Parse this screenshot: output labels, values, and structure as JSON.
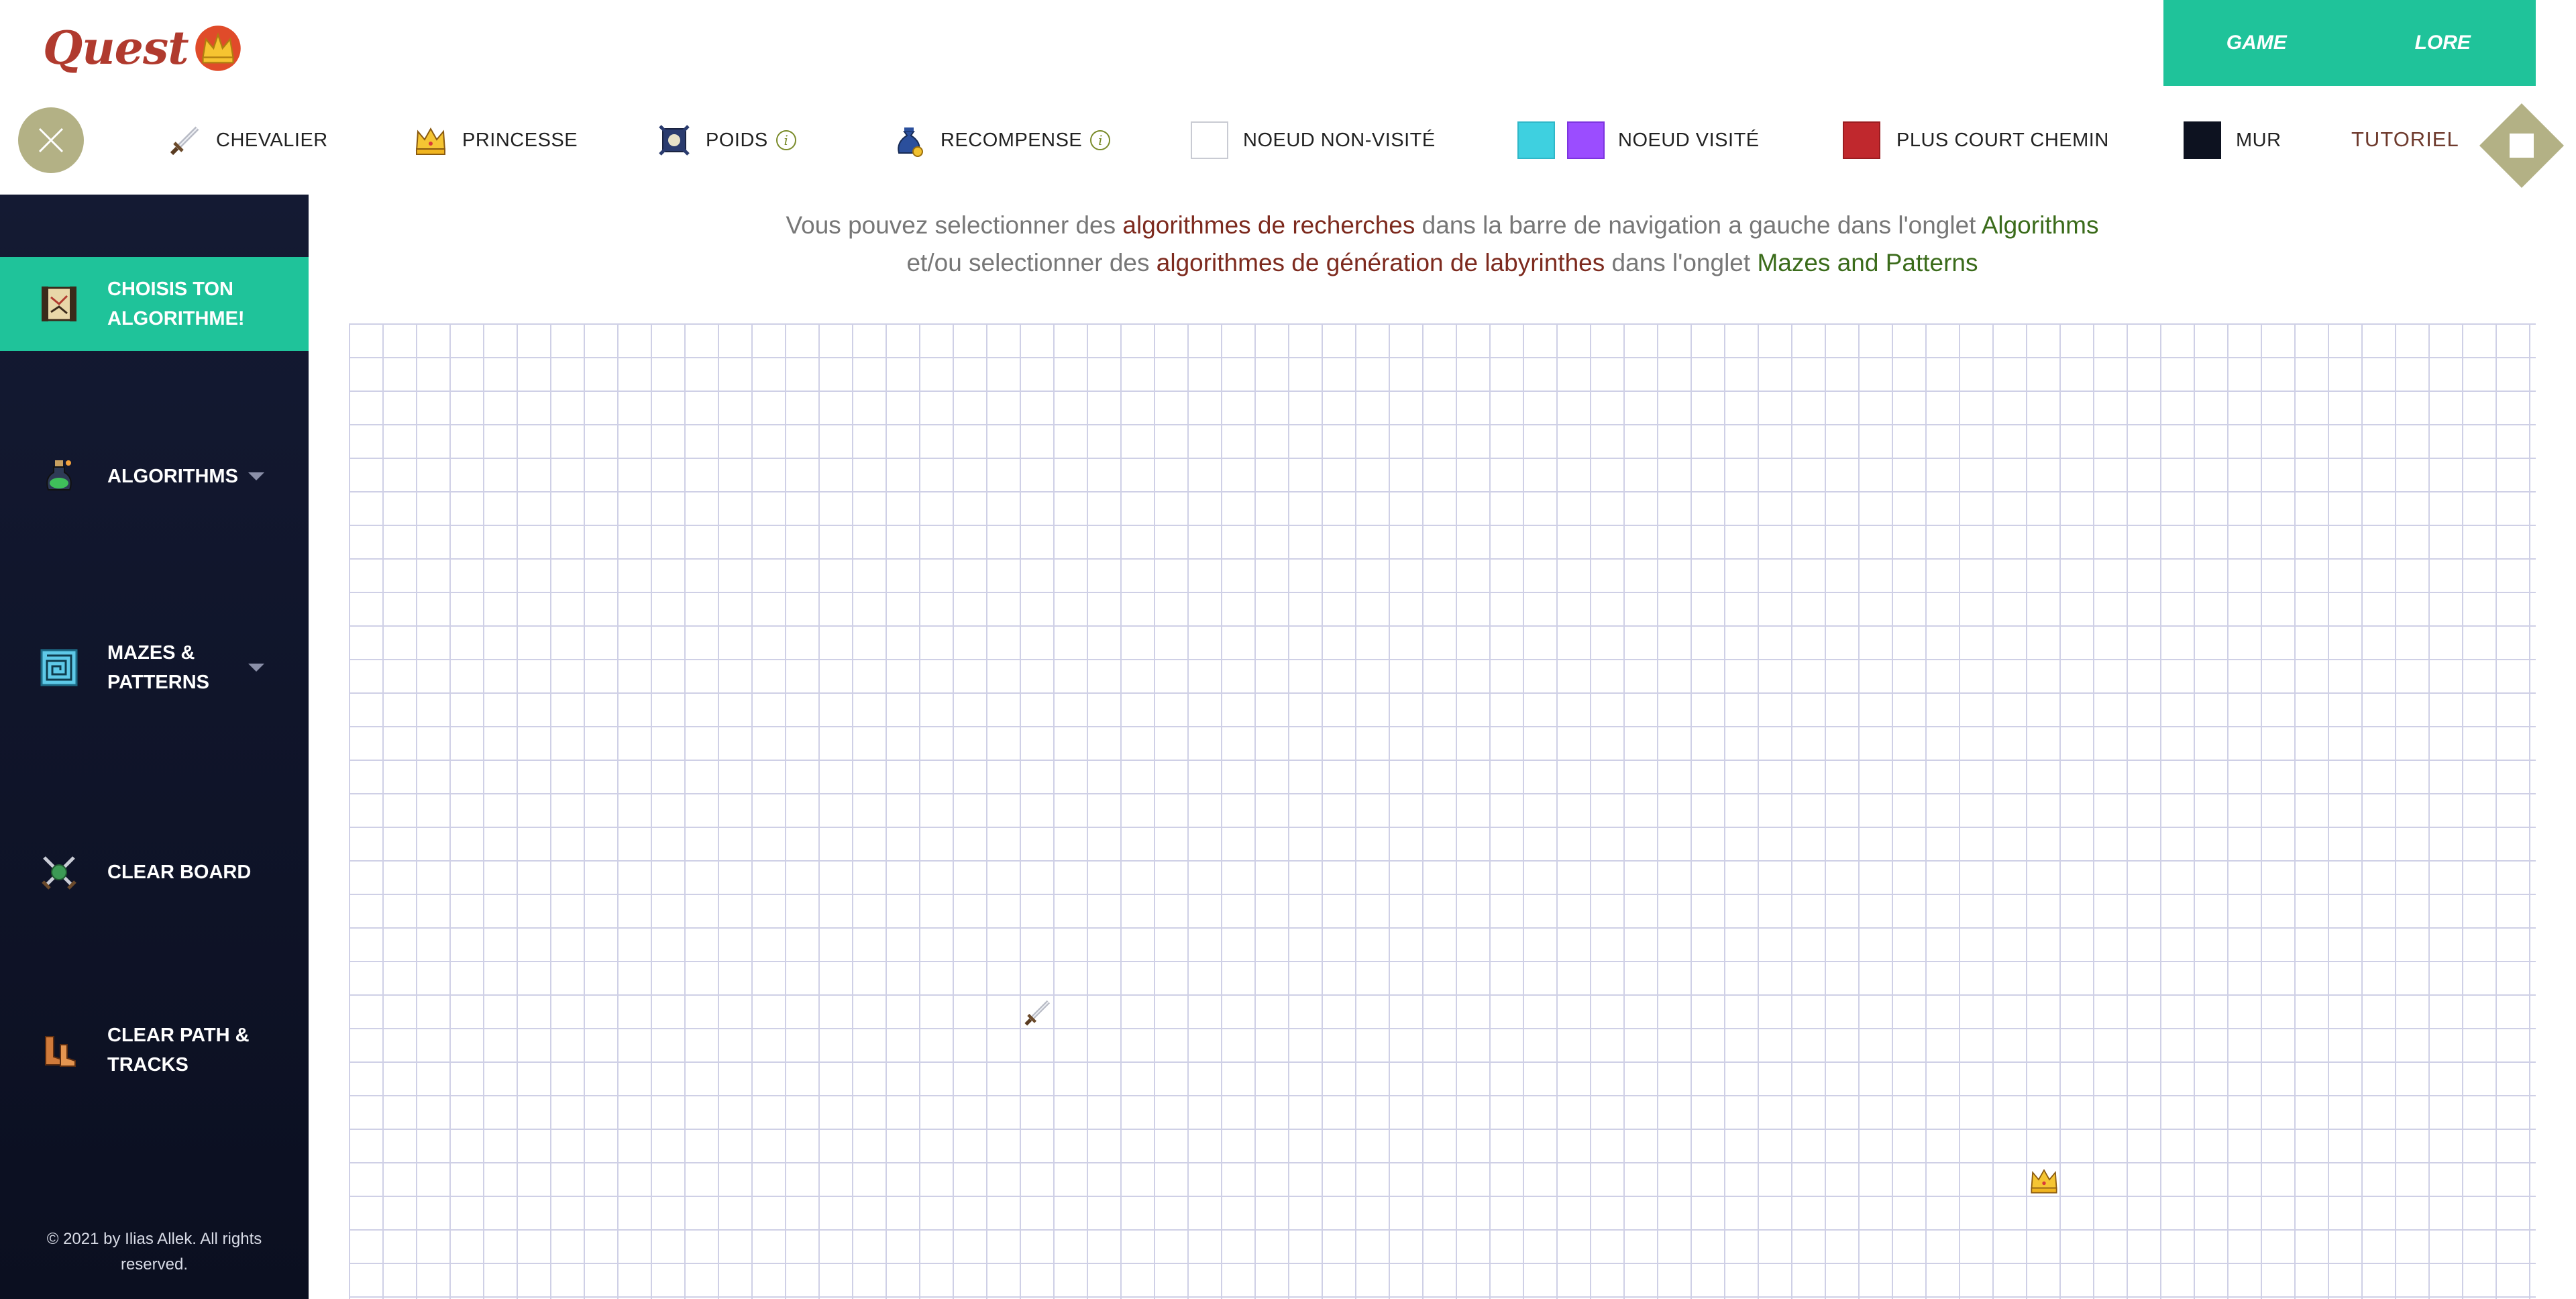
{
  "brand": {
    "name": "Quest"
  },
  "topnav": {
    "items": [
      {
        "label": "GAME"
      },
      {
        "label": "LORE"
      }
    ]
  },
  "legend": {
    "chevalier": "CHEVALIER",
    "princesse": "PRINCESSE",
    "poids": "POIDS",
    "recompense": "RECOMPENSE",
    "unvisited": "NOEUD NON-VISITÉ",
    "visited": "NOEUD VISITÉ",
    "shortest": "PLUS COURT CHEMIN",
    "wall": "MUR",
    "info_glyph": "i"
  },
  "tutorial": {
    "label": "TUTORIEL"
  },
  "colors": {
    "accent": "#1fc39a",
    "visited_cyan": "#3ed0e0",
    "visited_purple": "#9b4dff",
    "shortest_path": "#c0282d",
    "wall": "#0d1220",
    "unvisited": "#ffffff"
  },
  "sidebar": {
    "items": [
      {
        "label": "CHOISIS TON ALGORITHME!",
        "icon": "scroll-icon",
        "active": true
      },
      {
        "label": "ALGORITHMS",
        "icon": "potion-icon",
        "caret": true
      },
      {
        "label": "MAZES & PATTERNS",
        "icon": "maze-icon",
        "caret": true
      },
      {
        "label": "CLEAR BOARD",
        "icon": "crossed-swords-icon"
      },
      {
        "label": "CLEAR PATH & TRACKS",
        "icon": "boots-icon"
      }
    ],
    "footer": "© 2021 by Ilias Allek. All rights reserved."
  },
  "instructions": {
    "line1": {
      "p1": "Vous pouvez selectionner des ",
      "h1": "algorithmes de recherches",
      "p2": " dans la barre de navigation a gauche dans l'onglet ",
      "h2": "Algorithms"
    },
    "line2": {
      "p1": "et/ou selectionner des ",
      "h1": "algorithmes de génération de labyrinthes",
      "p2": " dans l'onglet ",
      "h2": "Mazes and Patterns"
    }
  },
  "grid": {
    "columns": 65,
    "rows": 29,
    "start_node": {
      "col": 20,
      "row": 20,
      "icon": "sword-icon"
    },
    "target_node": {
      "col": 50,
      "row": 25,
      "icon": "crown-icon"
    }
  }
}
